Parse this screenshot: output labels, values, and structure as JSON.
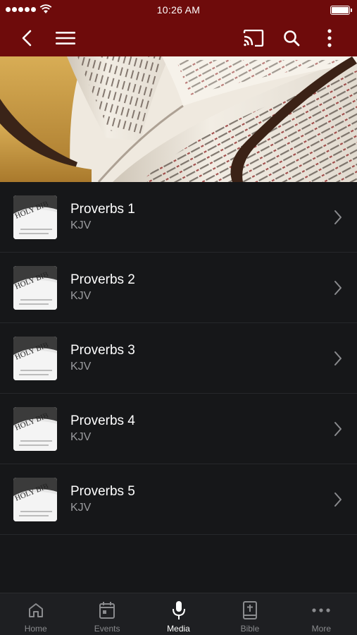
{
  "status_bar": {
    "time": "10:26 AM"
  },
  "navbar": {
    "back_icon": "chevron-left-icon",
    "menu_icon": "hamburger-menu-icon",
    "cast_icon": "cast-icon",
    "search_icon": "search-icon",
    "more_icon": "vertical-ellipsis-icon"
  },
  "list": {
    "items": [
      {
        "title": "Proverbs 1",
        "subtitle": "KJV"
      },
      {
        "title": "Proverbs 2",
        "subtitle": "KJV"
      },
      {
        "title": "Proverbs 3",
        "subtitle": "KJV"
      },
      {
        "title": "Proverbs 4",
        "subtitle": "KJV"
      },
      {
        "title": "Proverbs 5",
        "subtitle": "KJV"
      }
    ]
  },
  "tabbar": {
    "tabs": [
      {
        "label": "Home",
        "icon": "home-icon"
      },
      {
        "label": "Events",
        "icon": "calendar-icon"
      },
      {
        "label": "Media",
        "icon": "microphone-icon",
        "active": true
      },
      {
        "label": "Bible",
        "icon": "bible-icon"
      },
      {
        "label": "More",
        "icon": "horizontal-ellipsis-icon"
      }
    ]
  },
  "colors": {
    "header": "#6e0b0b",
    "background": "#161719",
    "tabbar": "#1e1f22",
    "subtitle": "#9a9b9e"
  }
}
